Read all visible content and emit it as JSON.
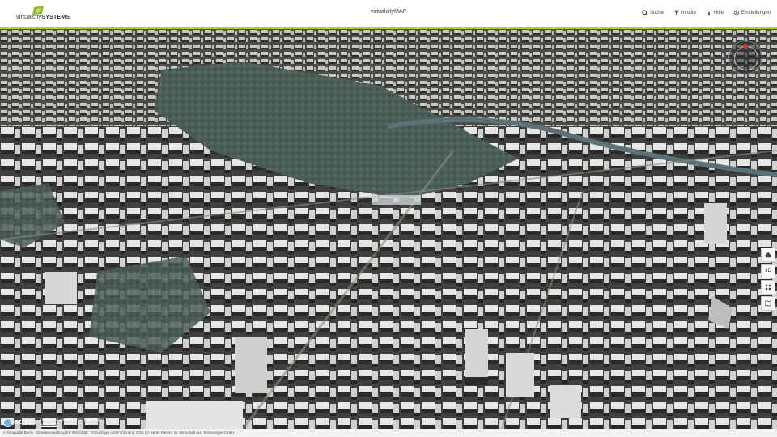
{
  "header": {
    "logo_text_a": "virtualcity",
    "logo_text_b": "SYSTEMS",
    "app_title": "virtualcityMAP",
    "nav": [
      {
        "label": "Suche",
        "icon": "search-icon"
      },
      {
        "label": "Inhalte",
        "icon": "filter-icon"
      },
      {
        "label": "Hilfe",
        "icon": "info-icon"
      },
      {
        "label": "Einstellungen",
        "icon": "gear-icon"
      }
    ]
  },
  "map_controls": [
    {
      "label": "",
      "icon": "home-icon"
    },
    {
      "label": "3D",
      "icon": "3d-icon"
    },
    {
      "label": "",
      "icon": "grid-icon"
    },
    {
      "label": "",
      "icon": "map-icon"
    }
  ],
  "credits": {
    "cesium": "CESIUM",
    "made_by": "realized by",
    "made_by_link": "virtualcitySYSTEMS GmbH",
    "impressum": "Impressum"
  },
  "footer": {
    "text": "© Geoportal Berlin · Senatsverwaltung für Wirtschaft, Technologie und Forschung 2015 | © Berlin Partner für Wirtschaft und Technologie GmbH"
  },
  "colors": {
    "accent": "#b8c93a",
    "header_bg": "#ffffff"
  }
}
